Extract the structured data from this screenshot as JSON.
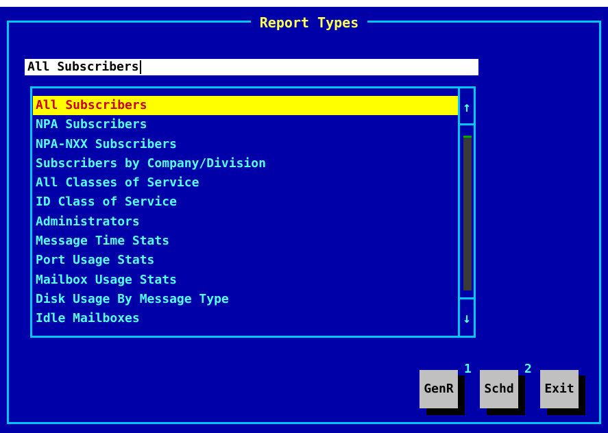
{
  "dialog": {
    "title": "Report Types",
    "input_value": "All Subscribers"
  },
  "list": {
    "items": [
      "All Subscribers",
      "NPA Subscribers",
      "NPA-NXX Subscribers",
      "Subscribers by Company/Division",
      "All Classes of Service",
      "ID Class of Service",
      "Administrators",
      "Message Time Stats",
      "Port Usage Stats",
      "Mailbox Usage Stats",
      "Disk Usage By Message Type",
      "Idle Mailboxes"
    ],
    "selected_index": 0
  },
  "scrollbar": {
    "up_icon": "arrow-up-icon",
    "down_icon": "arrow-down-icon"
  },
  "buttons": {
    "genr_label": "GenR",
    "genr_hotkey": "1",
    "schd_label": "Schd",
    "schd_hotkey": "2",
    "exit_label": "Exit"
  },
  "colors": {
    "background": "#0000a8",
    "border": "#00c8ff",
    "title_text": "#ffff55",
    "list_text": "#55ffff",
    "selected_bg": "#ffff00",
    "selected_text": "#cc0000",
    "button_face": "#c0c0c0"
  }
}
